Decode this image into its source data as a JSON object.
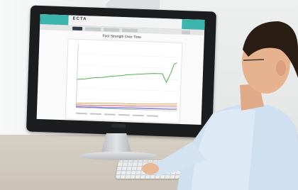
{
  "scene": {
    "description_colors": {
      "teal_accent": "#3bb5ae",
      "series_green": "#4caf50",
      "series_orange": "#f28e2b",
      "series_red": "#e15759",
      "series_purple": "#9c6ade",
      "series_blue": "#4e79a7"
    }
  },
  "app": {
    "brand": "ECTA",
    "chart_title": "Fast Strength Over Time"
  },
  "icons": {
    "callout": "speech-bubble-icon",
    "logo": "brand-logo-icon"
  }
}
